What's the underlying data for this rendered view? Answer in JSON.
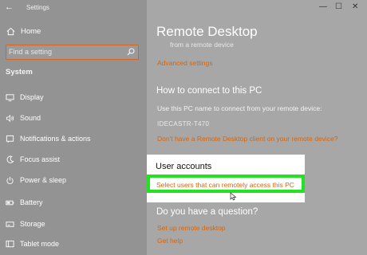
{
  "window": {
    "title": "Settings",
    "back_glyph": "←"
  },
  "sidebar": {
    "home_label": "Home",
    "search_placeholder": "Find a setting",
    "section": "System",
    "items": [
      {
        "label": "Display",
        "icon": "display-icon"
      },
      {
        "label": "Sound",
        "icon": "sound-icon"
      },
      {
        "label": "Notifications & actions",
        "icon": "notifications-icon"
      },
      {
        "label": "Focus assist",
        "icon": "focus-assist-icon"
      },
      {
        "label": "Power & sleep",
        "icon": "power-icon"
      },
      {
        "label": "Battery",
        "icon": "battery-icon"
      },
      {
        "label": "Storage",
        "icon": "storage-icon"
      },
      {
        "label": "Tablet mode",
        "icon": "tablet-mode-icon"
      }
    ]
  },
  "main": {
    "title": "Remote Desktop",
    "subtitle": "from a remote device",
    "advanced_link": "Advanced settings",
    "connect_heading": "How to connect to this PC",
    "connect_text": "Use this PC name to connect from your remote device:",
    "pc_name": "IDECASTR-T470",
    "client_link": "Don't have a Remote Desktop client on your remote device?",
    "user_accounts_heading": "User accounts",
    "select_users_link": "Select users that can remotely access this PC",
    "question_heading": "Do you have a question?",
    "setup_link": "Set up remote desktop",
    "help_link": "Get help"
  },
  "colors": {
    "accent": "#d6660f",
    "highlight": "#22e322",
    "sidebar_bg": "#939393",
    "main_bg": "#a7a7a7"
  }
}
